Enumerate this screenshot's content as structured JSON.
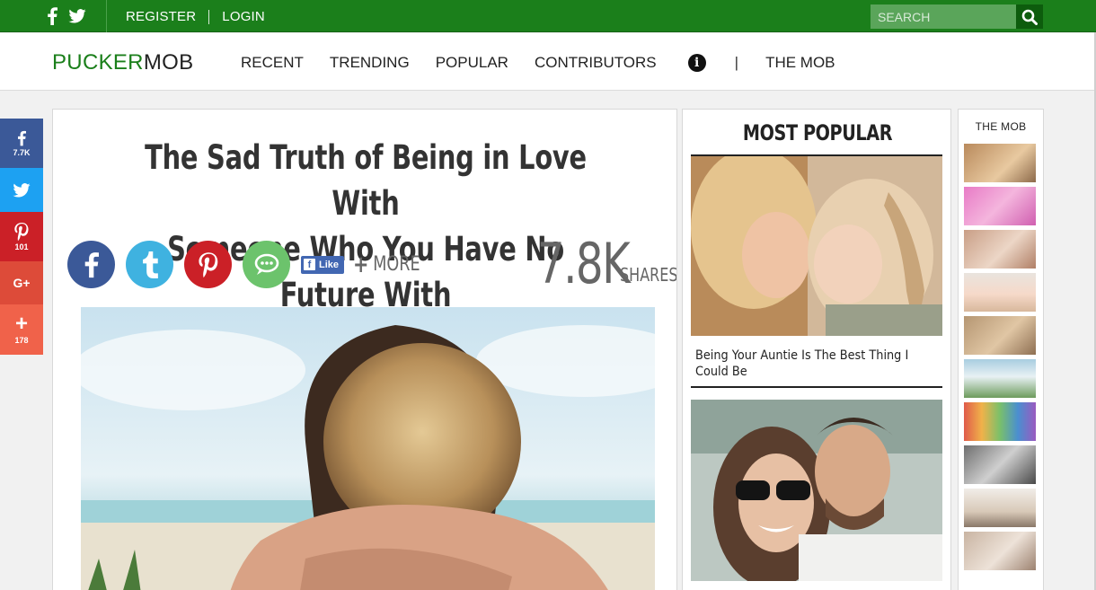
{
  "topbar": {
    "register": "REGISTER",
    "login": "LOGIN",
    "search_placeholder": "SEARCH"
  },
  "brand": {
    "logo_part1": "PUCKER",
    "logo_part2": "MOB"
  },
  "nav": {
    "items": [
      "RECENT",
      "TRENDING",
      "POPULAR",
      "CONTRIBUTORS"
    ],
    "separator": "|",
    "the_mob": "THE MOB"
  },
  "share_rail": {
    "facebook_count": "7.7K",
    "pinterest_count": "101",
    "googleplus_label": "G+",
    "more_count": "178"
  },
  "article": {
    "title_line1": "The Sad Truth of Being in Love With",
    "title_line2": "Someone Who You Have No Future With",
    "like_label": "Like",
    "more_label": "MORE",
    "share_count": "7.8K",
    "share_label": "SHARES"
  },
  "most_popular": {
    "heading": "MOST POPULAR",
    "items": [
      {
        "caption": "Being Your Auntie Is The Best Thing I Could Be"
      }
    ]
  },
  "the_mob_panel": {
    "heading": "THE MOB"
  },
  "colors": {
    "brand_green": "#1b7f1b",
    "facebook": "#3b5998",
    "twitter": "#1da1f2",
    "pinterest": "#cb2027",
    "googleplus": "#dd4b39",
    "more": "#f0624a"
  }
}
